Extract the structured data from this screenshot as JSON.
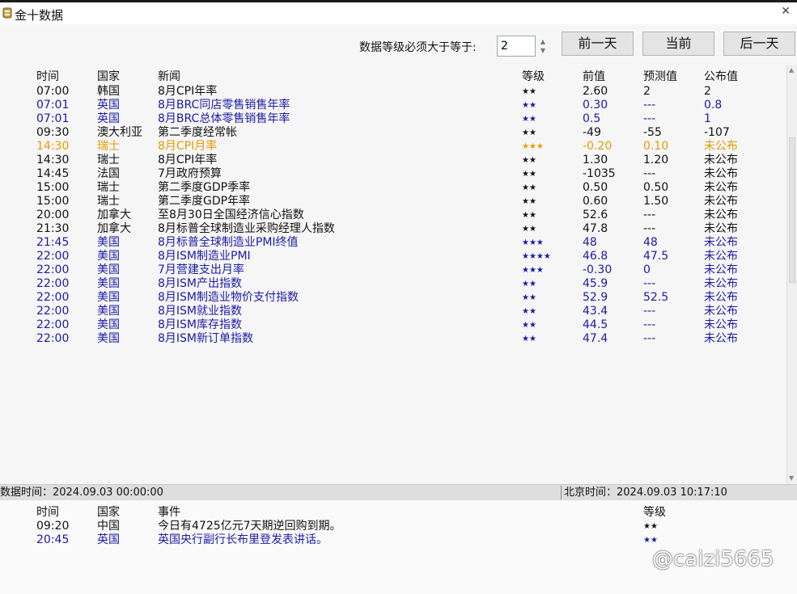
{
  "window": {
    "title": "金十数据",
    "close_glyph": "✕"
  },
  "controls": {
    "level_label": "数据等级必须大于等于:",
    "level_value": "2",
    "prev_day": "前一天",
    "today": "当前",
    "next_day": "后一天"
  },
  "colors": {
    "black": "#111111",
    "blue": "#1a1aa8",
    "orange": "#e89a00"
  },
  "table": {
    "headers": [
      "时间",
      "国家",
      "新闻",
      "等级",
      "前值",
      "预测值",
      "公布值"
    ],
    "rows": [
      {
        "time": "07:00",
        "country": "韩国",
        "news": "8月CPI年率",
        "level": "★★",
        "prev": "2.60",
        "forecast": "2",
        "actual": "2",
        "color": "black"
      },
      {
        "time": "07:01",
        "country": "英国",
        "news": "8月BRC同店零售销售年率",
        "level": "★★",
        "prev": "0.30",
        "forecast": "---",
        "actual": "0.8",
        "color": "blue"
      },
      {
        "time": "07:01",
        "country": "英国",
        "news": "8月BRC总体零售销售年率",
        "level": "★★",
        "prev": "0.5",
        "forecast": "---",
        "actual": "1",
        "color": "blue"
      },
      {
        "time": "09:30",
        "country": "澳大利亚",
        "news": "第二季度经常帐",
        "level": "★★",
        "prev": "-49",
        "forecast": "-55",
        "actual": "-107",
        "color": "black"
      },
      {
        "time": "14:30",
        "country": "瑞士",
        "news": "8月CPI月率",
        "level": "★★★",
        "prev": "-0.20",
        "forecast": "0.10",
        "actual": "未公布",
        "color": "orange"
      },
      {
        "time": "14:30",
        "country": "瑞士",
        "news": "8月CPI年率",
        "level": "★★",
        "prev": "1.30",
        "forecast": "1.20",
        "actual": "未公布",
        "color": "black"
      },
      {
        "time": "14:45",
        "country": "法国",
        "news": "7月政府预算",
        "level": "★★",
        "prev": "-1035",
        "forecast": "---",
        "actual": "未公布",
        "color": "black"
      },
      {
        "time": "15:00",
        "country": "瑞士",
        "news": "第二季度GDP季率",
        "level": "★★",
        "prev": "0.50",
        "forecast": "0.50",
        "actual": "未公布",
        "color": "black"
      },
      {
        "time": "15:00",
        "country": "瑞士",
        "news": "第二季度GDP年率",
        "level": "★★",
        "prev": "0.60",
        "forecast": "1.50",
        "actual": "未公布",
        "color": "black"
      },
      {
        "time": "20:00",
        "country": "加拿大",
        "news": "至8月30日全国经济信心指数",
        "level": "★★",
        "prev": "52.6",
        "forecast": "---",
        "actual": "未公布",
        "color": "black"
      },
      {
        "time": "21:30",
        "country": "加拿大",
        "news": "8月标普全球制造业采购经理人指数",
        "level": "★★",
        "prev": "47.8",
        "forecast": "---",
        "actual": "未公布",
        "color": "black"
      },
      {
        "time": "21:45",
        "country": "美国",
        "news": "8月标普全球制造业PMI终值",
        "level": "★★★",
        "prev": "48",
        "forecast": "48",
        "actual": "未公布",
        "color": "blue"
      },
      {
        "time": "22:00",
        "country": "美国",
        "news": "8月ISM制造业PMI",
        "level": "★★★★",
        "prev": "46.8",
        "forecast": "47.5",
        "actual": "未公布",
        "color": "blue"
      },
      {
        "time": "22:00",
        "country": "美国",
        "news": "7月营建支出月率",
        "level": "★★★",
        "prev": "-0.30",
        "forecast": "0",
        "actual": "未公布",
        "color": "blue"
      },
      {
        "time": "22:00",
        "country": "美国",
        "news": "8月ISM产出指数",
        "level": "★★",
        "prev": "45.9",
        "forecast": "---",
        "actual": "未公布",
        "color": "blue"
      },
      {
        "time": "22:00",
        "country": "美国",
        "news": "8月ISM制造业物价支付指数",
        "level": "★★",
        "prev": "52.9",
        "forecast": "52.5",
        "actual": "未公布",
        "color": "blue"
      },
      {
        "time": "22:00",
        "country": "美国",
        "news": "8月ISM就业指数",
        "level": "★★",
        "prev": "43.4",
        "forecast": "---",
        "actual": "未公布",
        "color": "blue"
      },
      {
        "time": "22:00",
        "country": "美国",
        "news": "8月ISM库存指数",
        "level": "★★",
        "prev": "44.5",
        "forecast": "---",
        "actual": "未公布",
        "color": "blue"
      },
      {
        "time": "22:00",
        "country": "美国",
        "news": "8月ISM新订单指数",
        "level": "★★",
        "prev": "47.4",
        "forecast": "---",
        "actual": "未公布",
        "color": "blue"
      }
    ]
  },
  "status": {
    "data_time": "数据时间：2024.09.03 00:00:00",
    "beijing_time": "北京时间：2024.09.03 10:17:10"
  },
  "events": {
    "headers": [
      "时间",
      "国家",
      "事件",
      "等级"
    ],
    "rows": [
      {
        "time": "09:20",
        "country": "中国",
        "event": "今日有4725亿元7天期逆回购到期。",
        "level": "★★",
        "color": "black"
      },
      {
        "time": "20:45",
        "country": "英国",
        "event": "英国央行副行长布里登发表讲话。",
        "level": "★★",
        "color": "blue"
      }
    ]
  },
  "watermark": "@caizi5665"
}
